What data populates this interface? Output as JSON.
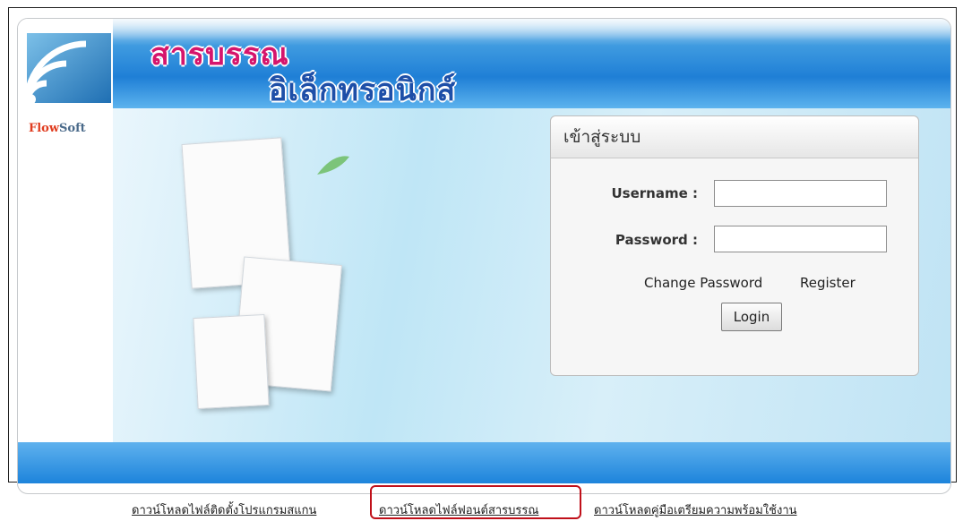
{
  "brand": {
    "logo_text_a": "Flow",
    "logo_text_b": "Soft",
    "title_line1": "สารบรรณ",
    "title_line2": "อิเล็กทรอนิกส์"
  },
  "login": {
    "heading": "เข้าสู่ระบบ",
    "username_label": "Username :",
    "password_label": "Password :",
    "username_value": "",
    "password_value": "",
    "change_password_link": "Change Password",
    "register_link": "Register",
    "login_button": "Login"
  },
  "downloads": {
    "link1": "ดาวน์โหลดไฟล์ติดตั้งโปรแกรมสแกน",
    "link2": "ดาวน์โหลดไฟล์ฟอนต์สารบรรณ",
    "link3": "ดาวน์โหลดคู่มือเตรียมความพร้อมใช้งาน"
  },
  "colors": {
    "banner_blue": "#1f7fd6",
    "title_pink": "#d5156c",
    "title_navy": "#1e4fa8",
    "highlight_red": "#c0101a"
  }
}
